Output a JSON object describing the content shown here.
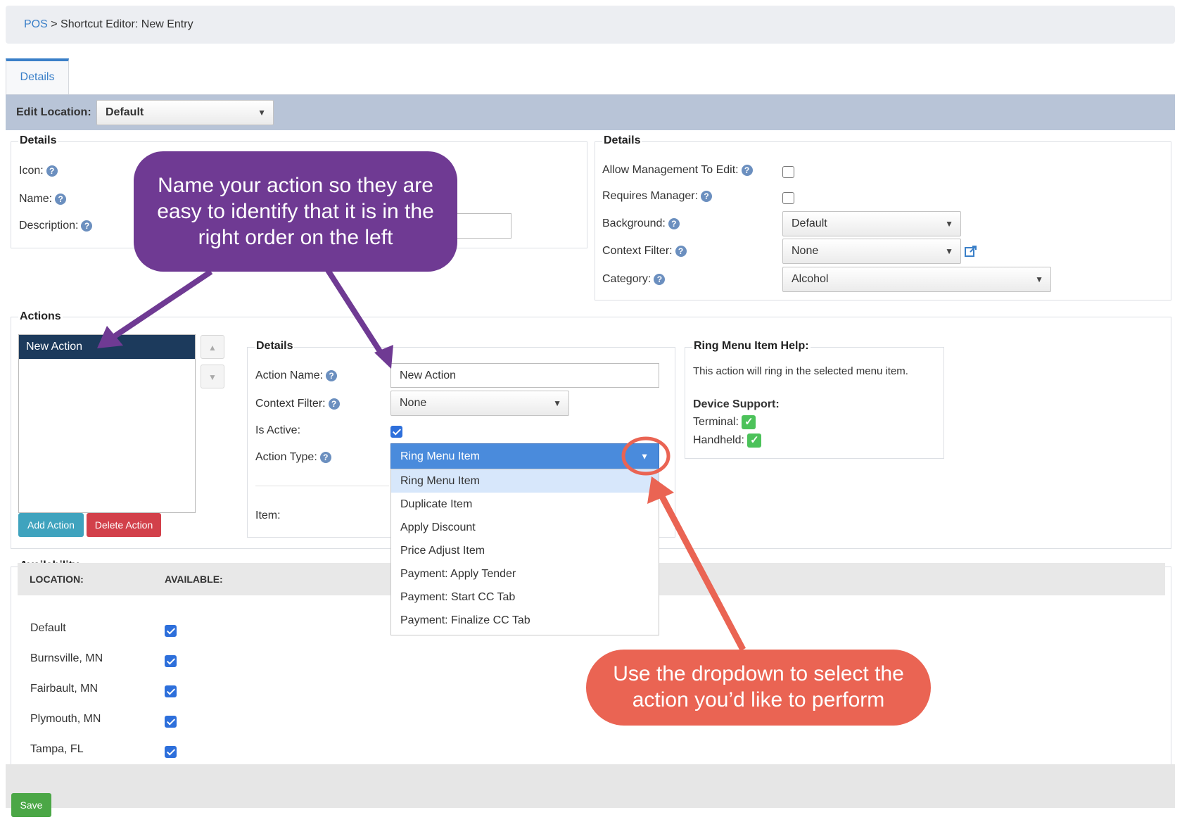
{
  "breadcrumb": {
    "root": "POS",
    "separator": ">",
    "current": "Shortcut Editor: New Entry"
  },
  "tabs": [
    {
      "label": "Details"
    }
  ],
  "edit_location": {
    "label": "Edit Location:",
    "value": "Default"
  },
  "left_details": {
    "legend": "Details",
    "icon_label": "Icon:",
    "name_label": "Name:",
    "description_label": "Description:"
  },
  "right_details": {
    "legend": "Details",
    "allow_mgmt_label": "Allow Management To Edit:",
    "requires_manager_label": "Requires Manager:",
    "background_label": "Background:",
    "background_value": "Default",
    "context_filter_label": "Context Filter:",
    "context_filter_value": "None",
    "category_label": "Category:",
    "category_value": "Alcohol"
  },
  "actions": {
    "legend": "Actions",
    "list": [
      "New Action"
    ],
    "add_button": "Add Action",
    "delete_button": "Delete Action"
  },
  "action_details": {
    "legend": "Details",
    "action_name_label": "Action Name:",
    "action_name_value": "New Action",
    "context_filter_label": "Context Filter:",
    "context_filter_value": "None",
    "is_active_label": "Is Active:",
    "action_type_label": "Action Type:",
    "action_type_value": "Ring Menu Item",
    "item_label": "Item:",
    "action_type_options": [
      "Ring Menu Item",
      "Duplicate Item",
      "Apply Discount",
      "Price Adjust Item",
      "Payment: Apply Tender",
      "Payment: Start CC Tab",
      "Payment: Finalize CC Tab"
    ]
  },
  "help_panel": {
    "legend": "Ring Menu Item Help:",
    "text": "This action will ring in the selected menu item.",
    "device_support_label": "Device Support:",
    "terminal_label": "Terminal:",
    "handheld_label": "Handheld:"
  },
  "availability": {
    "legend": "Availability",
    "col_location": "LOCATION:",
    "col_available": "AVAILABLE:",
    "rows": [
      "Default",
      "Burnsville, MN",
      "Fairbault, MN",
      "Plymouth, MN",
      "Tampa, FL"
    ]
  },
  "save_button": "Save",
  "callouts": {
    "purple": "Name your action so they are easy to identify that it is in the right order on the left",
    "red": "Use the dropdown to select the action you’d like to perform"
  },
  "colors": {
    "link": "#3a7fc8",
    "callout_purple": "#6f3a93",
    "callout_red": "#ea6453",
    "add_button": "#3fa3be",
    "delete_button": "#d2404a",
    "save_button": "#4ba746",
    "selected_dropdown": "#4a8bdc",
    "selected_list": "#1c3a5c"
  }
}
